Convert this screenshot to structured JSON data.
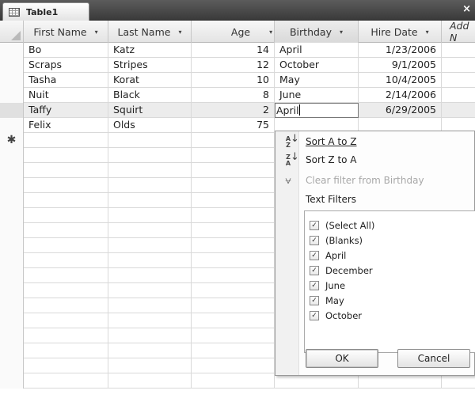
{
  "window": {
    "tab_title": "Table1",
    "close_glyph": "×"
  },
  "columns": [
    {
      "label": "First Name",
      "dropdown": "▾"
    },
    {
      "label": "Last Name",
      "dropdown": "▾"
    },
    {
      "label": "Age",
      "dropdown": "▾"
    },
    {
      "label": "Birthday",
      "dropdown": "▾"
    },
    {
      "label": "Hire Date",
      "dropdown": "▾"
    },
    {
      "label": "Add N"
    }
  ],
  "rows": [
    {
      "first": "Bo",
      "last": "Katz",
      "age": "14",
      "birthday": "April",
      "hire": "1/23/2006"
    },
    {
      "first": "Scraps",
      "last": "Stripes",
      "age": "12",
      "birthday": "October",
      "hire": "9/1/2005"
    },
    {
      "first": "Tasha",
      "last": "Korat",
      "age": "10",
      "birthday": "May",
      "hire": "10/4/2005"
    },
    {
      "first": "Nuit",
      "last": "Black",
      "age": "8",
      "birthday": "June",
      "hire": "2/14/2006"
    },
    {
      "first": "Taffy",
      "last": "Squirt",
      "age": "2",
      "birthday": "April",
      "hire": "6/29/2005"
    },
    {
      "first": "Felix",
      "last": "Olds",
      "age": "75",
      "birthday": "",
      "hire": ""
    }
  ],
  "new_record_marker": "✱",
  "filter_menu": {
    "sort_asc": "Sort A to Z",
    "sort_desc": "Sort Z to A",
    "clear_filter": "Clear filter from Birthday",
    "text_filters": "Text Filters",
    "options": [
      {
        "label": "(Select All)",
        "checked": true
      },
      {
        "label": "(Blanks)",
        "checked": true
      },
      {
        "label": "April",
        "checked": true
      },
      {
        "label": "December",
        "checked": true
      },
      {
        "label": "June",
        "checked": true
      },
      {
        "label": "May",
        "checked": true
      },
      {
        "label": "October",
        "checked": true
      }
    ],
    "ok_label": "OK",
    "cancel_label": "Cancel"
  },
  "icons": {
    "table": "table-icon",
    "sort_asc": "sort-ascending-icon",
    "sort_desc": "sort-descending-icon",
    "clear_filter": "clear-filter-icon",
    "check": "✓"
  }
}
